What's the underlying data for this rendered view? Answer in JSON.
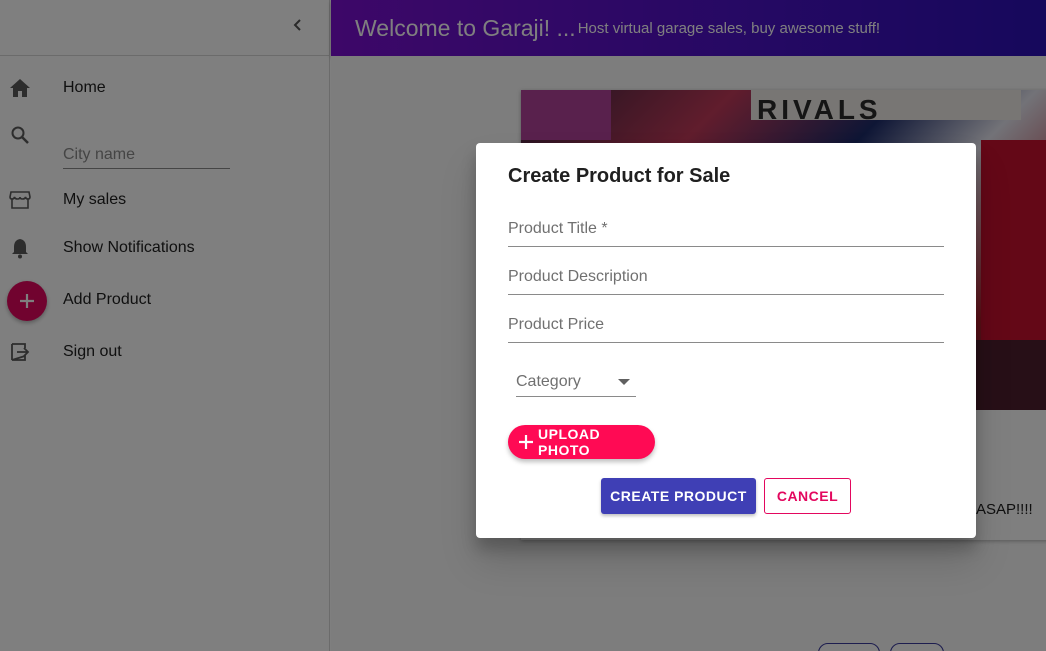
{
  "header": {
    "title": "Welcome to Garaji! ...",
    "subtitle": "Host virtual garage sales, buy awesome stuff!"
  },
  "sidebar": {
    "collapse_icon": "chevron-left-icon",
    "items": [
      {
        "label": "Home",
        "icon": "home-icon"
      },
      {
        "placeholder": "City name",
        "value": "",
        "icon": "search-icon"
      },
      {
        "label": "My sales",
        "icon": "storefront-icon"
      },
      {
        "label": "Show Notifications",
        "icon": "bell-icon"
      },
      {
        "label": "Add Product",
        "icon": "add-icon"
      },
      {
        "label": "Sign out",
        "icon": "exit-icon"
      }
    ]
  },
  "main": {
    "product_description_partial": "ASAP!!!!",
    "image_text": "RIVALS"
  },
  "dialog": {
    "title": "Create Product for Sale",
    "fields": {
      "title_placeholder": "Product Title *",
      "description_placeholder": "Product Description",
      "price_placeholder": "Product Price"
    },
    "category_label": "Category",
    "upload_label": "UPLOAD PHOTO",
    "create_label": "CREATE PRODUCT",
    "cancel_label": "CANCEL"
  },
  "colors": {
    "accent_pink": "#e3075e",
    "upload_pink": "#ff0a54",
    "primary_indigo": "#3f3fb5",
    "header_gradient_start": "#7b0fd1",
    "header_gradient_end": "#2c10b8"
  }
}
